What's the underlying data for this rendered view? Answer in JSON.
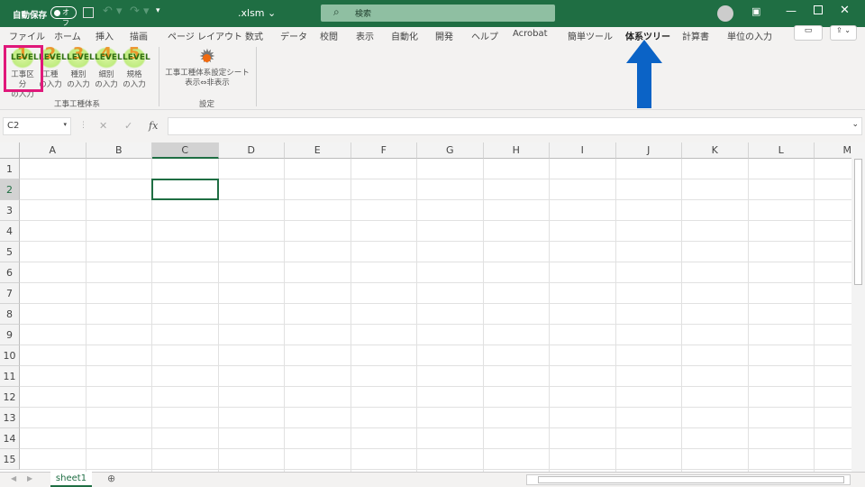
{
  "titlebar": {
    "autosave": "自動保存",
    "toggle": "オフ",
    "filename": ".xlsm",
    "search_placeholder": "検索"
  },
  "tabs": [
    "ファイル",
    "ホーム",
    "挿入",
    "描画",
    "ページ レイアウト",
    "数式",
    "データ",
    "校閲",
    "表示",
    "自動化",
    "開発",
    "ヘルプ",
    "Acrobat",
    "簡単ツール",
    "体系ツリー",
    "計算書",
    "単位の入力"
  ],
  "active_tab": "体系ツリー",
  "ribbon": {
    "group1": {
      "label": "工事工種体系",
      "buttons": [
        {
          "num": "1",
          "icon": "LEVEL",
          "line1": "工事区分",
          "line2": "の入力"
        },
        {
          "num": "2",
          "icon": "LEVEL",
          "line1": "工種",
          "line2": "の入力"
        },
        {
          "num": "3",
          "icon": "LEVEL",
          "line1": "種別",
          "line2": "の入力"
        },
        {
          "num": "4",
          "icon": "LEVEL",
          "line1": "細別",
          "line2": "の入力"
        },
        {
          "num": "5",
          "icon": "LEVEL",
          "line1": "規格",
          "line2": "の入力"
        }
      ]
    },
    "group2": {
      "label": "設定",
      "button": {
        "line1": "工事工種体系設定シート",
        "line2": "表示⇔非表示"
      }
    }
  },
  "formula_bar": {
    "name_box": "C2",
    "fx": "fx",
    "cancel": "✕",
    "enter": "✓",
    "value": ""
  },
  "columns": [
    "A",
    "B",
    "C",
    "D",
    "E",
    "F",
    "G",
    "H",
    "I",
    "J",
    "K",
    "L",
    "M"
  ],
  "rows": [
    "1",
    "2",
    "3",
    "4",
    "5",
    "6",
    "7",
    "8",
    "9",
    "10",
    "11",
    "12",
    "13",
    "14",
    "15"
  ],
  "selected_cell": "C2",
  "sheet_tabs": [
    "sheet1"
  ],
  "colors": {
    "accent": "#1f6e43",
    "highlight": "#e0187a",
    "arrow": "#0b63c6"
  }
}
